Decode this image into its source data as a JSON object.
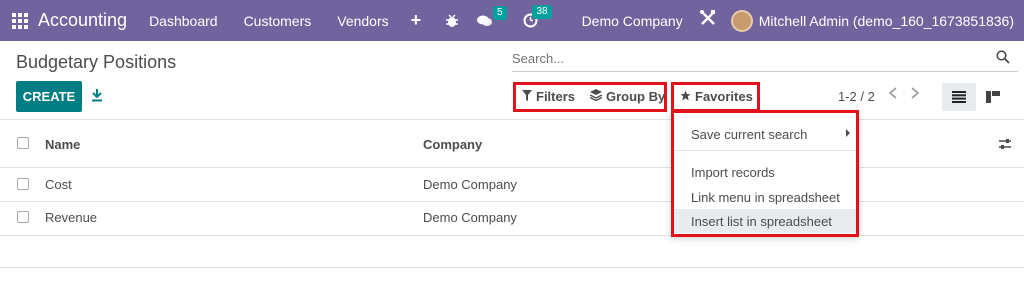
{
  "navbar": {
    "app_title": "Accounting",
    "menu": [
      "Dashboard",
      "Customers",
      "Vendors"
    ],
    "plus": "+",
    "messages_badge": "5",
    "activities_badge": "38",
    "company": "Demo Company",
    "user": "Mitchell Admin (demo_160_1673851836)",
    "bg_color": "#71639e"
  },
  "control_panel": {
    "title": "Budgetary Positions",
    "search_placeholder": "Search...",
    "create_label": "CREATE",
    "filters_label": "Filters",
    "groupby_label": "Group By",
    "favorites_label": "Favorites",
    "pager": "1-2 / 2",
    "accent_color": "#017e84"
  },
  "table": {
    "columns": [
      "Name",
      "Company"
    ],
    "rows": [
      {
        "name": "Cost",
        "company": "Demo Company"
      },
      {
        "name": "Revenue",
        "company": "Demo Company"
      }
    ]
  },
  "favorites_menu": {
    "items": [
      "Save current search",
      "Import records",
      "Link menu in spreadsheet",
      "Insert list in spreadsheet"
    ],
    "highlight_color": "#e3121a"
  }
}
